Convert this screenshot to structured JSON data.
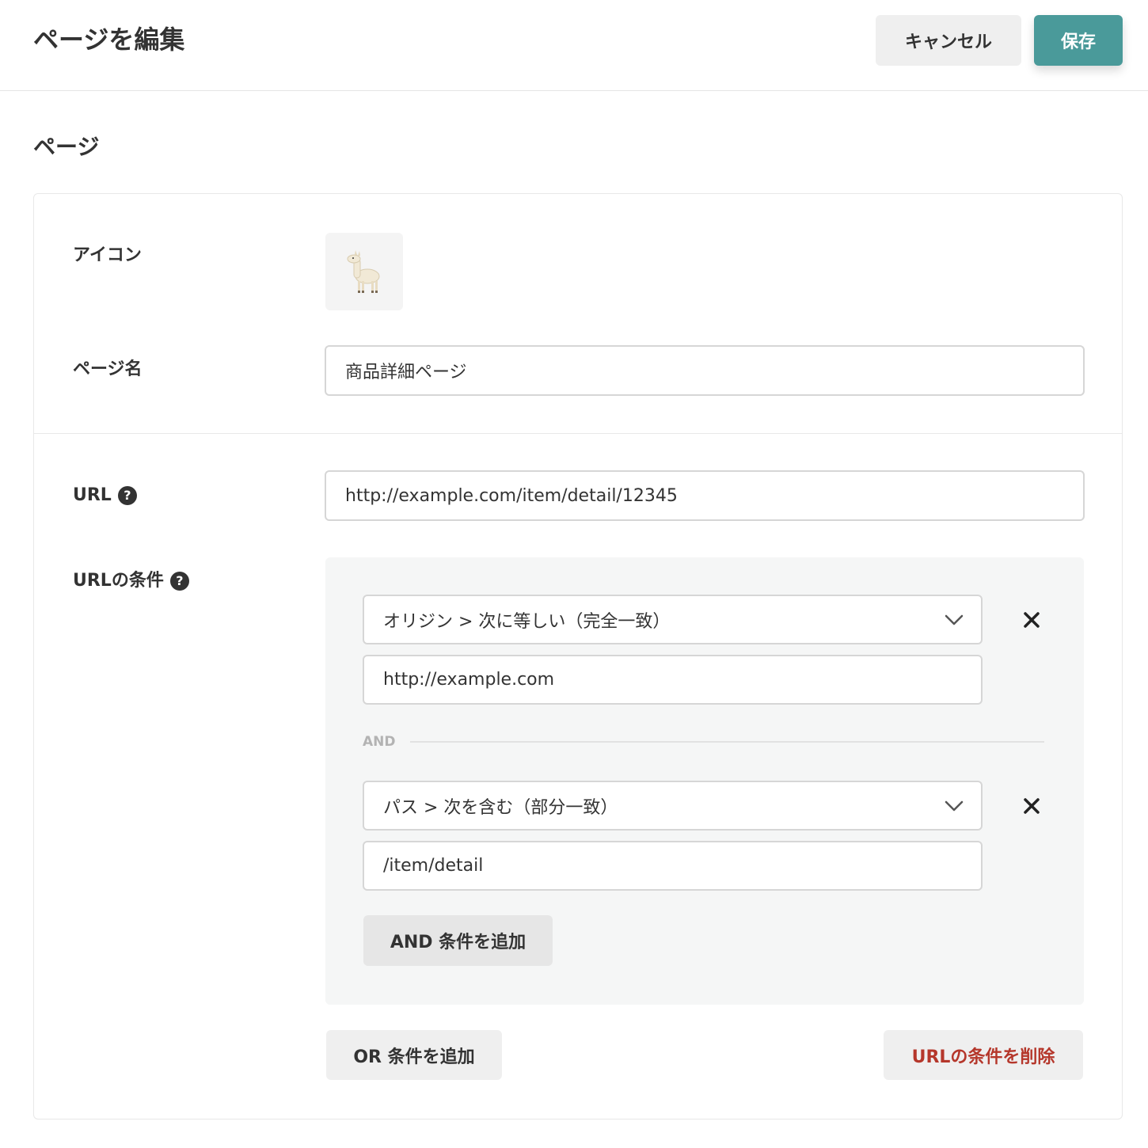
{
  "header": {
    "title": "ページを編集",
    "cancel_label": "キャンセル",
    "save_label": "保存"
  },
  "section": {
    "title": "ページ"
  },
  "form": {
    "icon_label": "アイコン",
    "icon_emoji": "llama-icon",
    "page_name_label": "ページ名",
    "page_name_value": "商品詳細ページ",
    "url_label": "URL",
    "url_value": "http://example.com/item/detail/12345",
    "url_conditions_label": "URLの条件",
    "help_icon": "?"
  },
  "conditions": [
    {
      "select_value": "オリジン > 次に等しい（完全一致）",
      "input_value": "http://example.com"
    },
    {
      "select_value": "パス > 次を含む（部分一致）",
      "input_value": "/item/detail"
    }
  ],
  "and_separator": "AND",
  "buttons": {
    "add_and": "AND 条件を追加",
    "add_or": "OR 条件を追加",
    "delete_url_conditions": "URLの条件を削除"
  },
  "colors": {
    "primary": "#4a9a9a",
    "danger": "#b5372b",
    "text": "#333333"
  }
}
